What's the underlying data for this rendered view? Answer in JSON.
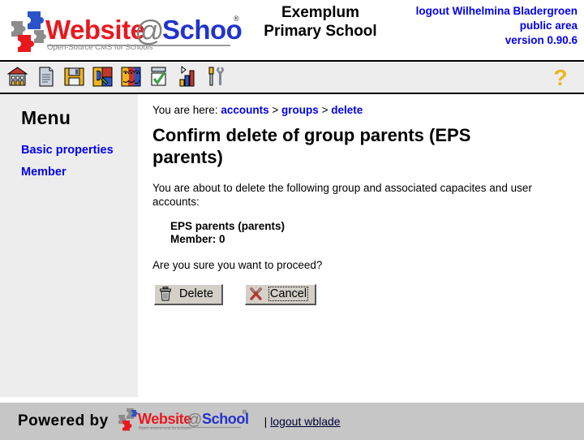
{
  "header": {
    "logo_text": "Website@School",
    "logo_tagline": "Open-Source CMS for Schools",
    "logo_registered": "®",
    "school_name_line1": "Exemplum",
    "school_name_line2": "Primary School",
    "account_logout": "logout Wilhelmina Bladergroen",
    "account_area": "public area",
    "account_version": "version 0.90.6"
  },
  "toolbar": {
    "icons": [
      {
        "name": "home-icon",
        "title": "Home"
      },
      {
        "name": "page-icon",
        "title": "Pages"
      },
      {
        "name": "save-icon",
        "title": "Save"
      },
      {
        "name": "modules-icon",
        "title": "Modules"
      },
      {
        "name": "accounts-icon",
        "title": "Accounts"
      },
      {
        "name": "tasks-icon",
        "title": "Tasks"
      },
      {
        "name": "statistics-icon",
        "title": "Statistics"
      },
      {
        "name": "tools-icon",
        "title": "Tools"
      }
    ],
    "help_icon": "help-question-icon"
  },
  "sidebar": {
    "title": "Menu",
    "items": [
      {
        "label": "Basic properties"
      },
      {
        "label": "Member"
      }
    ]
  },
  "main": {
    "breadcrumb_prefix": "You are here:",
    "breadcrumb": [
      {
        "label": "accounts"
      },
      {
        "label": "groups"
      },
      {
        "label": "delete"
      }
    ],
    "breadcrumb_separator": ">",
    "title": "Confirm delete of group parents (EPS parents)",
    "lead": "You are about to delete the following group and associated capacites and user accounts:",
    "details": [
      "EPS parents (parents)",
      "Member: 0"
    ],
    "confirm_question": "Are you sure you want to proceed?",
    "delete_button": "Delete",
    "cancel_button": "Cancel",
    "delete_icon": "trash-icon",
    "cancel_icon": "cancel-cross-icon"
  },
  "footer": {
    "powered_by": "Powered by",
    "logo_text": "Website@School",
    "logo_tagline": "Open source cms for schools",
    "separator": "|",
    "logout_link": "logout wblade"
  },
  "colors": {
    "link": "#0000ee",
    "logo_red": "#e8191e",
    "logo_blue": "#2233cc",
    "logo_gray": "#808080",
    "toolbar_bg": "#ededed",
    "footer_bg": "#c6c6c6",
    "help_yellow": "#e8b820"
  }
}
